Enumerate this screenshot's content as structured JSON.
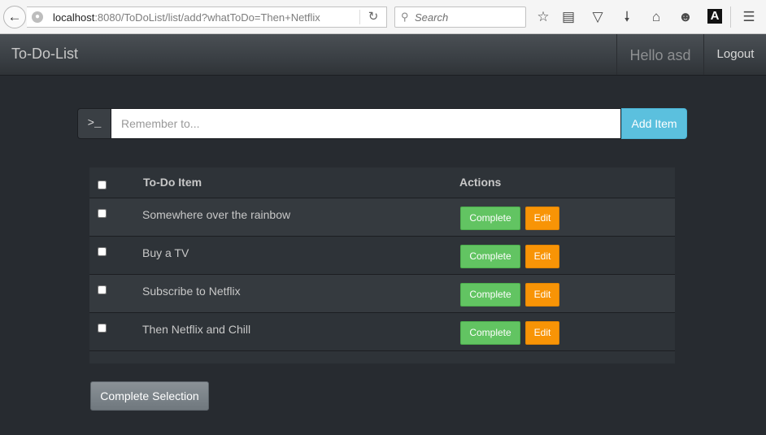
{
  "browser": {
    "url_host": "localhost",
    "url_rest": ":8080/ToDoList/list/add?whatToDo=Then+Netflix",
    "search_placeholder": "Search",
    "toolbar_icons": [
      "star-icon",
      "reading-list-icon",
      "pocket-icon",
      "download-icon",
      "home-icon",
      "smiley-icon",
      "a-letter-icon",
      "hamburger-menu-icon"
    ],
    "a_letter": "A"
  },
  "navbar": {
    "brand": "To-Do-List",
    "greeting": "Hello asd",
    "logout": "Logout"
  },
  "add_form": {
    "prompt": ">_",
    "placeholder": "Remember to...",
    "button": "Add Item"
  },
  "table": {
    "headers": {
      "item": "To-Do Item",
      "actions": "Actions"
    },
    "rows": [
      {
        "item": "Somewhere over the rainbow",
        "complete": "Complete",
        "edit": "Edit"
      },
      {
        "item": "Buy a TV",
        "complete": "Complete",
        "edit": "Edit"
      },
      {
        "item": "Subscribe to Netflix",
        "complete": "Complete",
        "edit": "Edit"
      },
      {
        "item": "Then Netflix and Chill",
        "complete": "Complete",
        "edit": "Edit"
      }
    ]
  },
  "complete_selection": "Complete Selection",
  "colors": {
    "page_bg": "#272b30",
    "info": "#5bc0de",
    "success": "#62c462",
    "warning": "#f89406",
    "default_btn": "#7a8288"
  }
}
